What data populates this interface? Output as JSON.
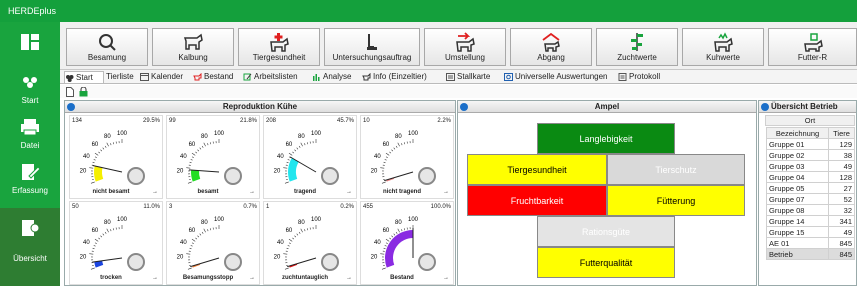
{
  "app": {
    "title": "HERDEplus"
  },
  "nav": [
    {
      "label": "",
      "icon": "tile-icon"
    },
    {
      "label": "Start",
      "icon": "start-icon"
    },
    {
      "label": "Datei",
      "icon": "printer-icon"
    },
    {
      "label": "Erfassung",
      "icon": "edit-icon"
    },
    {
      "label": "Übersicht",
      "icon": "chart-icon"
    }
  ],
  "ribbon": [
    {
      "label": "Besamung",
      "icon": "search-icon"
    },
    {
      "label": "Kalbung",
      "icon": "cow-icon"
    },
    {
      "label": "Tiergesundheit",
      "icon": "health-icon"
    },
    {
      "label": "Untersuchungsauftrag",
      "icon": "lab-icon"
    },
    {
      "label": "Umstellung",
      "icon": "move-icon"
    },
    {
      "label": "Abgang",
      "icon": "exit-icon"
    },
    {
      "label": "Zuchtwerte",
      "icon": "bars-icon"
    },
    {
      "label": "Kuhwerte",
      "icon": "cow-value-icon"
    },
    {
      "label": "Futter-R",
      "icon": "feed-icon"
    }
  ],
  "tabs": [
    "Start",
    "Tierliste",
    "Kalender",
    "Bestand",
    "Arbeitslisten",
    "Analyse",
    "Info (Einzeltier)",
    "Stallkarte",
    "Universelle Auswertungen",
    "Protokoll"
  ],
  "reproduktion": {
    "title": "Reproduktion Kühe",
    "ticks": [
      "20",
      "40",
      "60",
      "80",
      "100"
    ],
    "gauges": [
      {
        "count": "134",
        "pct": "29.5%",
        "label": "nicht besamt",
        "dash": "→",
        "color": "#f5ef00",
        "level": 0.295
      },
      {
        "count": "99",
        "pct": "21.8%",
        "label": "besamt",
        "dash": "→",
        "color": "#22dd22",
        "level": 0.218
      },
      {
        "count": "208",
        "pct": "45.7%",
        "label": "tragend",
        "dash": "→",
        "color": "#22e6ee",
        "level": 0.457
      },
      {
        "count": "10",
        "pct": "2.2%",
        "label": "nicht tragend",
        "dash": "→",
        "color": "#f08a8a",
        "level": 0.022
      },
      {
        "count": "50",
        "pct": "11.0%",
        "label": "trocken",
        "dash": "→",
        "color": "#1b44e0",
        "level": 0.11
      },
      {
        "count": "3",
        "pct": "0.7%",
        "label": "Besamungsstopp",
        "dash": "→",
        "color": "#f0803a",
        "level": 0.007
      },
      {
        "count": "1",
        "pct": "0.2%",
        "label": "zuchtuntauglich",
        "dash": "→",
        "color": "#e81010",
        "level": 0.002
      },
      {
        "count": "455",
        "pct": "100.0%",
        "label": "Bestand",
        "dash": "→",
        "color": "#8a2be2",
        "level": 1.0
      }
    ]
  },
  "ampel": {
    "title": "Ampel",
    "cells": [
      {
        "label": "Langlebigkeit",
        "bg": "#0a8a12",
        "fg": "#ffffff"
      },
      {
        "label": "Tiergesundheit",
        "bg": "#ffff00",
        "fg": "#000000"
      },
      {
        "label": "Tierschutz",
        "bg": "#d9d9d9",
        "fg": "#ffffff"
      },
      {
        "label": "Fruchtbarkeit",
        "bg": "#ff0000",
        "fg": "#ffffff"
      },
      {
        "label": "Fütterung",
        "bg": "#ffff00",
        "fg": "#000000"
      },
      {
        "label": "Rationsgüte",
        "bg": "#e4e4e4",
        "fg": "#ffffff"
      },
      {
        "label": "Futterqualität",
        "bg": "#ffff00",
        "fg": "#000000"
      }
    ]
  },
  "uebersicht": {
    "title": "Übersicht Betrieb",
    "header_group": "Ort",
    "columns": [
      "Bezeichnung",
      "Tiere"
    ],
    "rows": [
      [
        "Gruppe 01",
        "129"
      ],
      [
        "Gruppe 02",
        "38"
      ],
      [
        "Gruppe 03",
        "49"
      ],
      [
        "Gruppe 04",
        "128"
      ],
      [
        "Gruppe 05",
        "27"
      ],
      [
        "Gruppe 07",
        "52"
      ],
      [
        "Gruppe 08",
        "32"
      ],
      [
        "Gruppe 14",
        "341"
      ],
      [
        "Gruppe 15",
        "49"
      ],
      [
        "AE 01",
        "845"
      ],
      [
        "Betrieb",
        "845"
      ]
    ]
  }
}
